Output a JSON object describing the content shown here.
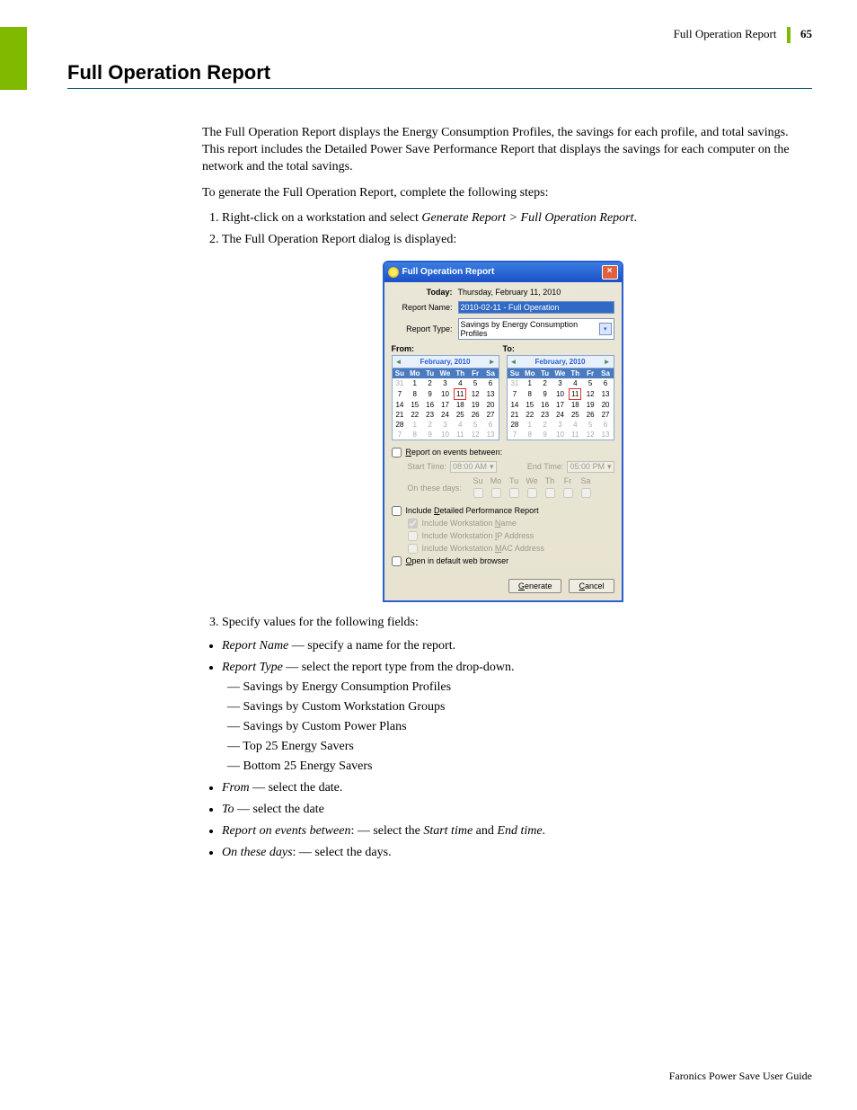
{
  "header": {
    "breadcrumb": "Full Operation Report",
    "page_number": "65"
  },
  "title": "Full Operation Report",
  "intro": "The Full Operation Report displays the Energy Consumption Profiles, the savings for each profile, and total savings. This report includes the Detailed Power Save Performance Report that displays the savings for each computer on the network and the total savings.",
  "intro2": "To generate the Full Operation Report, complete the following steps:",
  "steps": {
    "s1a": "Right-click on a workstation and select ",
    "s1b": "Generate Report > Full Operation Report",
    "s1c": ".",
    "s2": "The Full Operation Report dialog is displayed:",
    "s3": "Specify values for the following fields:"
  },
  "dialog": {
    "title": "Full Operation Report",
    "today_label": "Today:",
    "today_value": "Thursday, February 11, 2010",
    "report_name_label": "Report Name:",
    "report_name_value": "2010-02-11 - Full Operation",
    "report_type_label": "Report Type:",
    "report_type_value": "Savings by Energy Consumption Profiles",
    "from_label": "From:",
    "to_label": "To:",
    "cal_month": "February, 2010",
    "weekdays": [
      "Su",
      "Mo",
      "Tu",
      "We",
      "Th",
      "Fr",
      "Sa"
    ],
    "cal_weeks": [
      [
        "31",
        "1",
        "2",
        "3",
        "4",
        "5",
        "6"
      ],
      [
        "7",
        "8",
        "9",
        "10",
        "11",
        "12",
        "13"
      ],
      [
        "14",
        "15",
        "16",
        "17",
        "18",
        "19",
        "20"
      ],
      [
        "21",
        "22",
        "23",
        "24",
        "25",
        "26",
        "27"
      ],
      [
        "28",
        "1",
        "2",
        "3",
        "4",
        "5",
        "6"
      ],
      [
        "7",
        "8",
        "9",
        "10",
        "11",
        "12",
        "13"
      ]
    ],
    "report_events_label": "Report on events between:",
    "start_time_label": "Start Time:",
    "start_time_value": "08:00 AM",
    "end_time_label": "End Time:",
    "end_time_value": "05:00 PM",
    "on_these_days_label": "On these days:",
    "include_detailed": "Include Detailed Performance Report",
    "inc_ws_name": "Include Workstation Name",
    "inc_ws_ip": "Include Workstation IP Address",
    "inc_ws_mac": "Include Workstation MAC Address",
    "open_browser": "Open in default web browser",
    "generate": "Generate",
    "cancel": "Cancel"
  },
  "fields": {
    "report_name_term": "Report Name",
    "report_name_desc": " — specify a name for the report.",
    "report_type_term": "Report Type",
    "report_type_desc": " — select the report type from the drop-down.",
    "opts": {
      "a": "Savings by Energy Consumption Profiles",
      "b": "Savings by Custom Workstation Groups",
      "c": "Savings by Custom Power Plans",
      "d": "Top 25 Energy Savers",
      "e": "Bottom 25 Energy Savers"
    },
    "from_term": "From",
    "from_desc": " — select the date.",
    "to_term": "To",
    "to_desc": " — select the date",
    "events_term": "Report on events between",
    "events_desc_a": ": — select the ",
    "events_desc_b": "Start time",
    "events_desc_c": " and ",
    "events_desc_d": "End time",
    "events_desc_e": ".",
    "days_term": "On these days",
    "days_desc": ": — select the days."
  },
  "footer": "Faronics Power Save User Guide"
}
